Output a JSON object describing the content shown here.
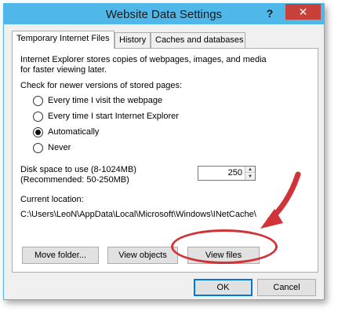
{
  "window": {
    "title": "Website Data Settings",
    "help_glyph": "?",
    "close_glyph": "✕"
  },
  "tabs": [
    {
      "label": "Temporary Internet Files",
      "active": true
    },
    {
      "label": "History",
      "active": false
    },
    {
      "label": "Caches and databases",
      "active": false
    }
  ],
  "content": {
    "intro_line1": "Internet Explorer stores copies of webpages, images, and media",
    "intro_line2": "for faster viewing later.",
    "check_heading": "Check for newer versions of stored pages:",
    "radio_options": [
      {
        "label": "Every time I visit the webpage",
        "checked": false
      },
      {
        "label": "Every time I start Internet Explorer",
        "checked": false
      },
      {
        "label": "Automatically",
        "checked": true
      },
      {
        "label": "Never",
        "checked": false
      }
    ],
    "disk_label_line1": "Disk space to use (8-1024MB)",
    "disk_label_line2": "(Recommended: 50-250MB)",
    "disk_value": "250",
    "current_location_label": "Current location:",
    "current_location_path": "C:\\Users\\LeoN\\AppData\\Local\\Microsoft\\Windows\\INetCache\\"
  },
  "panel_buttons": {
    "move_folder": "Move folder...",
    "view_objects": "View objects",
    "view_files": "View files"
  },
  "dialog_buttons": {
    "ok": "OK",
    "cancel": "Cancel"
  },
  "colors": {
    "title_bar": "#4fb8e8",
    "close_button": "#c7413a",
    "annotation": "#d13438",
    "default_button_border": "#0078d7"
  }
}
